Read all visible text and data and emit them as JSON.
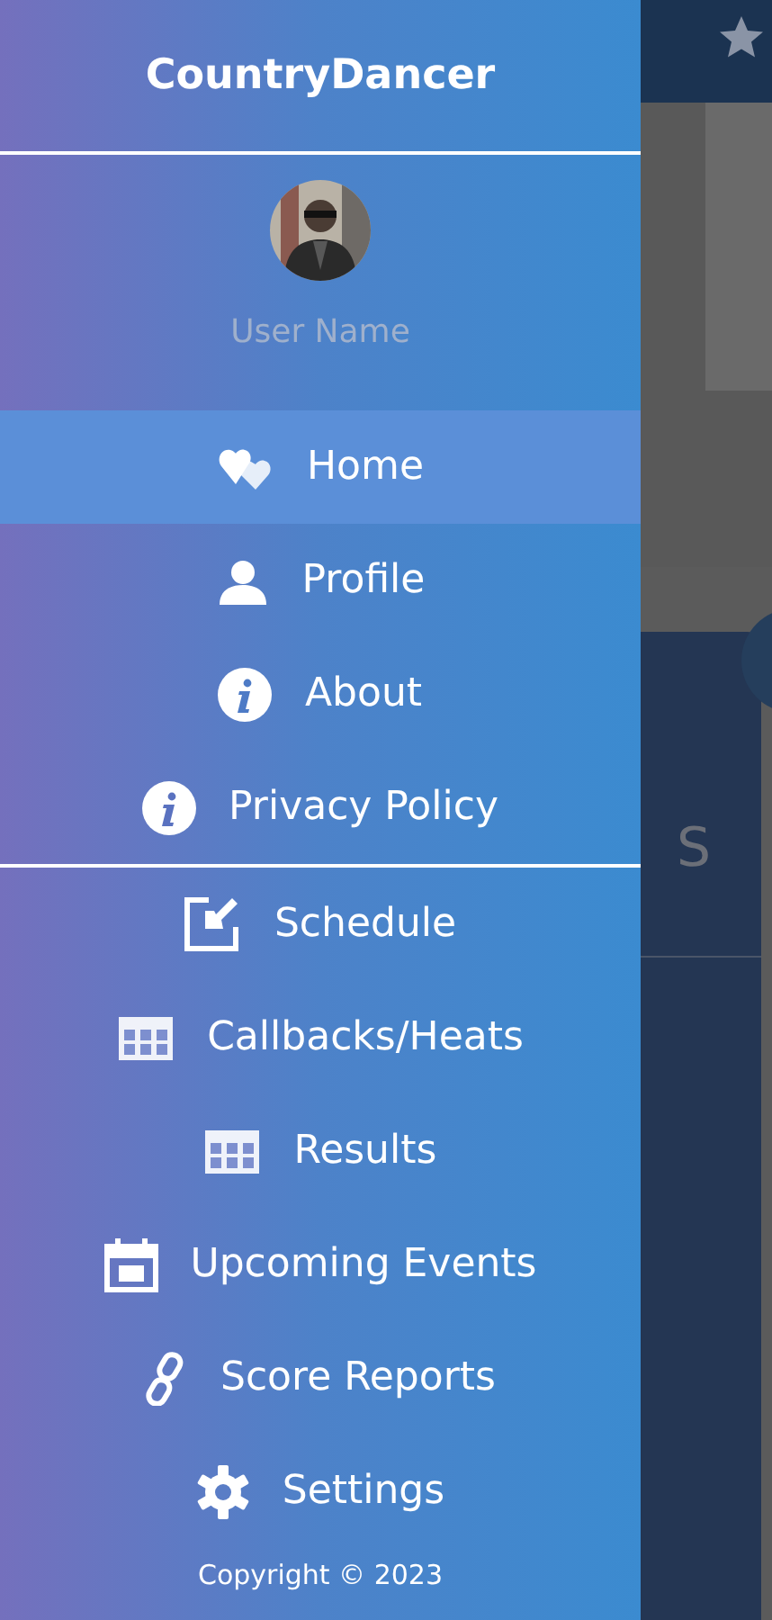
{
  "drawer": {
    "title": "CountryDancer",
    "user_name": "User Name",
    "sections": [
      {
        "items": [
          {
            "label": "Home",
            "selected": true
          },
          {
            "label": "Profile",
            "selected": false
          },
          {
            "label": "About",
            "selected": false
          },
          {
            "label": "Privacy Policy",
            "selected": false
          }
        ]
      },
      {
        "items": [
          {
            "label": "Schedule",
            "selected": false
          },
          {
            "label": "Callbacks/Heats",
            "selected": false
          },
          {
            "label": "Results",
            "selected": false
          },
          {
            "label": "Upcoming Events",
            "selected": false
          },
          {
            "label": "Score Reports",
            "selected": false
          },
          {
            "label": "Settings",
            "selected": false
          }
        ]
      }
    ],
    "copyright": "Copyright © 2023"
  },
  "background": {
    "card_text": "S"
  }
}
